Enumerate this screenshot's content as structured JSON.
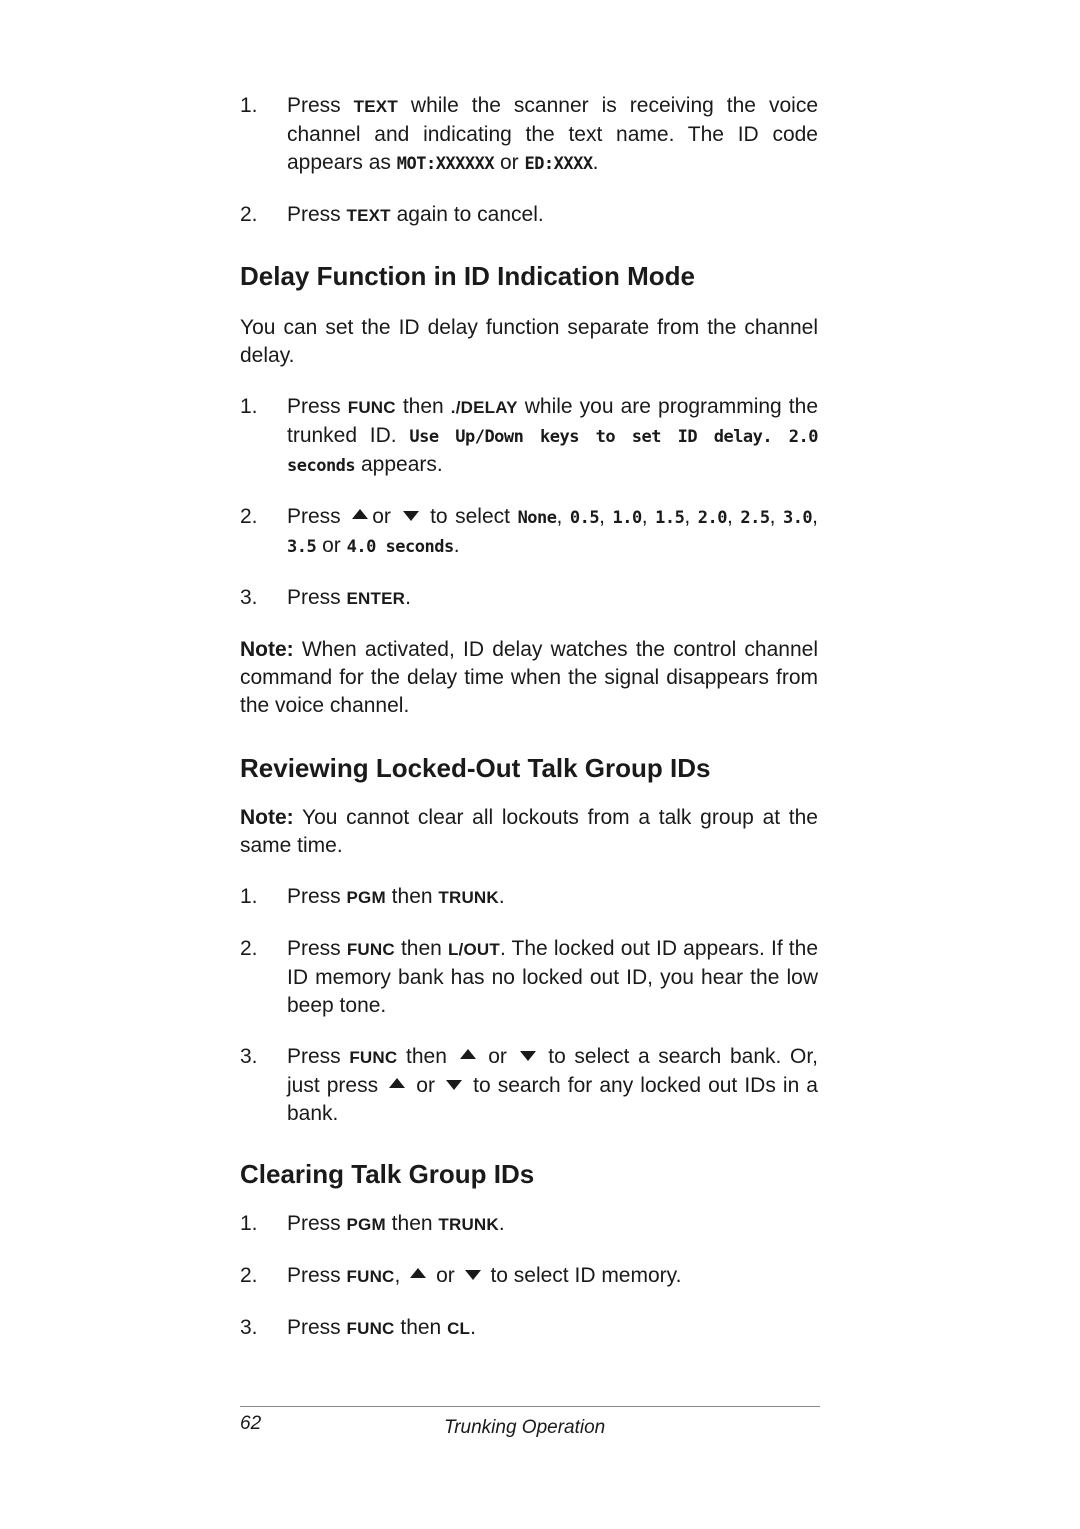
{
  "intro_steps": [
    {
      "num": "1.",
      "parts": [
        "Press ",
        "TEXT",
        " while the scanner is receiving the voice channel and indicating the text name. The ID code appears as ",
        "MOT:XXXXXX",
        " or ",
        "ED:XXXX",
        "."
      ]
    },
    {
      "num": "2.",
      "parts": [
        "Press ",
        "TEXT",
        " again to cancel."
      ]
    }
  ],
  "section1": {
    "heading": "Delay Function in ID Indication Mode",
    "intro": "You can set the ID delay function separate from the channel delay.",
    "step1": {
      "num": "1.",
      "a": "Press ",
      "k1": "FUNC",
      "b": " then ",
      "k2": "./DELAY",
      "c": " while you are programming the trunked ID. ",
      "lcd": "Use Up/Down keys to set ID delay. 2.0 seconds",
      "d": " appears."
    },
    "step2": {
      "num": "2.",
      "a": "Press",
      "b": "or",
      "c": "to select",
      "options": [
        "None",
        "0.5",
        "1.0",
        "1.5",
        "2.0",
        "2.5",
        "3.0",
        "3.5"
      ],
      "or": "or",
      "last": "4.0 seconds"
    },
    "step3": {
      "num": "3.",
      "a": "Press ",
      "k": "ENTER",
      "b": "."
    },
    "note_label": "Note:",
    "note": " When activated, ID delay watches the control channel command for the delay time when the signal disappears from the voice channel."
  },
  "section2": {
    "heading": "Reviewing Locked-Out Talk Group IDs",
    "note_label": "Note:",
    "note": " You cannot clear all lockouts from a talk group at the same time.",
    "step1": {
      "num": "1.",
      "a": "Press ",
      "k1": "PGM",
      "b": " then ",
      "k2": "TRUNK",
      "c": "."
    },
    "step2": {
      "num": "2.",
      "a": "Press ",
      "k1": "FUNC",
      "b": " then ",
      "k2": "L/OUT",
      "c": ". The locked out ID appears. If the ID memory bank has no locked out ID, you hear the low beep tone."
    },
    "step3": {
      "num": "3.",
      "a": "Press ",
      "k1": "FUNC",
      "b": " then",
      "c": "or",
      "d": "to select a search bank. Or, just press",
      "e": "or",
      "f": "to search for any locked out IDs in a bank."
    }
  },
  "section3": {
    "heading": "Clearing Talk Group IDs",
    "step1": {
      "num": "1.",
      "a": "Press ",
      "k1": "PGM",
      "b": " then ",
      "k2": "TRUNK",
      "c": "."
    },
    "step2": {
      "num": "2.",
      "a": "Press ",
      "k1": "FUNC",
      "b": ",",
      "c": "or",
      "d": "to select ID memory."
    },
    "step3": {
      "num": "3.",
      "a": "Press ",
      "k1": "FUNC",
      "b": " then ",
      "k2": "CL",
      "c": "."
    }
  },
  "footer": {
    "page_number": "62",
    "title": "Trunking Operation"
  }
}
